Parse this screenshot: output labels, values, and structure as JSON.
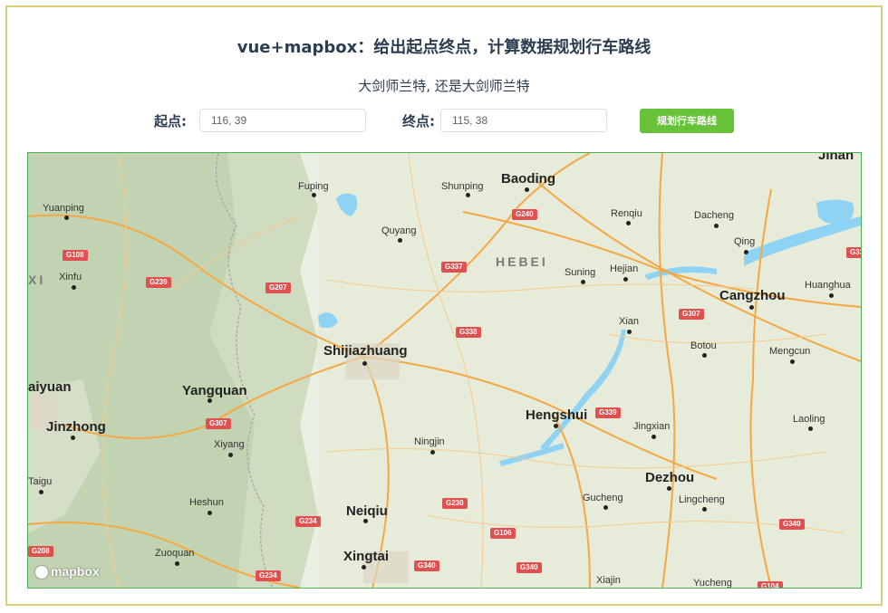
{
  "header": {
    "title": "vue+mapbox：给出起点终点，计算数据规划行车路线",
    "subtitle": "大剑师兰特, 还是大剑师兰特"
  },
  "form": {
    "start_label": "起点:",
    "start_value": "116, 39",
    "end_label": "终点:",
    "end_value": "115, 38",
    "button_label": "规划行车路线"
  },
  "map": {
    "region_label": "HEBEI",
    "left_region_label": "XI",
    "attribution": "mapbox",
    "cities": [
      {
        "name": "Baoding",
        "rank": "major"
      },
      {
        "name": "Shijiazhuang",
        "rank": "major"
      },
      {
        "name": "Hengshui",
        "rank": "major"
      },
      {
        "name": "Cangzhou",
        "rank": "major"
      },
      {
        "name": "Dezhou",
        "rank": "major"
      },
      {
        "name": "Xingtai",
        "rank": "major"
      },
      {
        "name": "Neiqiu",
        "rank": "major"
      },
      {
        "name": "Yangquan",
        "rank": "major"
      },
      {
        "name": "Jinzhong",
        "rank": "major"
      },
      {
        "name": "aiyuan",
        "rank": "major"
      },
      {
        "name": "Jinan",
        "rank": "major"
      },
      {
        "name": "Fuping",
        "rank": "minor"
      },
      {
        "name": "Shunping",
        "rank": "minor"
      },
      {
        "name": "Yuanping",
        "rank": "minor"
      },
      {
        "name": "Xinfu",
        "rank": "minor"
      },
      {
        "name": "Quyang",
        "rank": "minor"
      },
      {
        "name": "Renqiu",
        "rank": "minor"
      },
      {
        "name": "Dacheng",
        "rank": "minor"
      },
      {
        "name": "Qing",
        "rank": "minor"
      },
      {
        "name": "Suning",
        "rank": "minor"
      },
      {
        "name": "Hejian",
        "rank": "minor"
      },
      {
        "name": "Huanghua",
        "rank": "minor"
      },
      {
        "name": "Xian",
        "rank": "minor"
      },
      {
        "name": "Botou",
        "rank": "minor"
      },
      {
        "name": "Mengcun",
        "rank": "minor"
      },
      {
        "name": "Xiyang",
        "rank": "minor"
      },
      {
        "name": "Ningjin",
        "rank": "minor"
      },
      {
        "name": "Jingxian",
        "rank": "minor"
      },
      {
        "name": "Laoling",
        "rank": "minor"
      },
      {
        "name": "Taigu",
        "rank": "minor"
      },
      {
        "name": "Heshun",
        "rank": "minor"
      },
      {
        "name": "Gucheng",
        "rank": "minor"
      },
      {
        "name": "Lingcheng",
        "rank": "minor"
      },
      {
        "name": "Zuoquan",
        "rank": "minor"
      },
      {
        "name": "Xiajin",
        "rank": "minor"
      },
      {
        "name": "Yucheng",
        "rank": "minor"
      }
    ],
    "shields": [
      "G240",
      "G108",
      "G239",
      "G207",
      "G337",
      "G338",
      "G307",
      "G307",
      "G339",
      "G230",
      "G234",
      "G106",
      "G340",
      "G340",
      "G340",
      "G234",
      "G208",
      "G33",
      "G104"
    ]
  },
  "colors": {
    "accent": "#67c23a",
    "frame_border": "#ddd07a",
    "map_border": "#4caf50",
    "shield": "#e05050",
    "land": "#e9efe2",
    "water": "#8fd3f4",
    "road": "#f5a742"
  }
}
